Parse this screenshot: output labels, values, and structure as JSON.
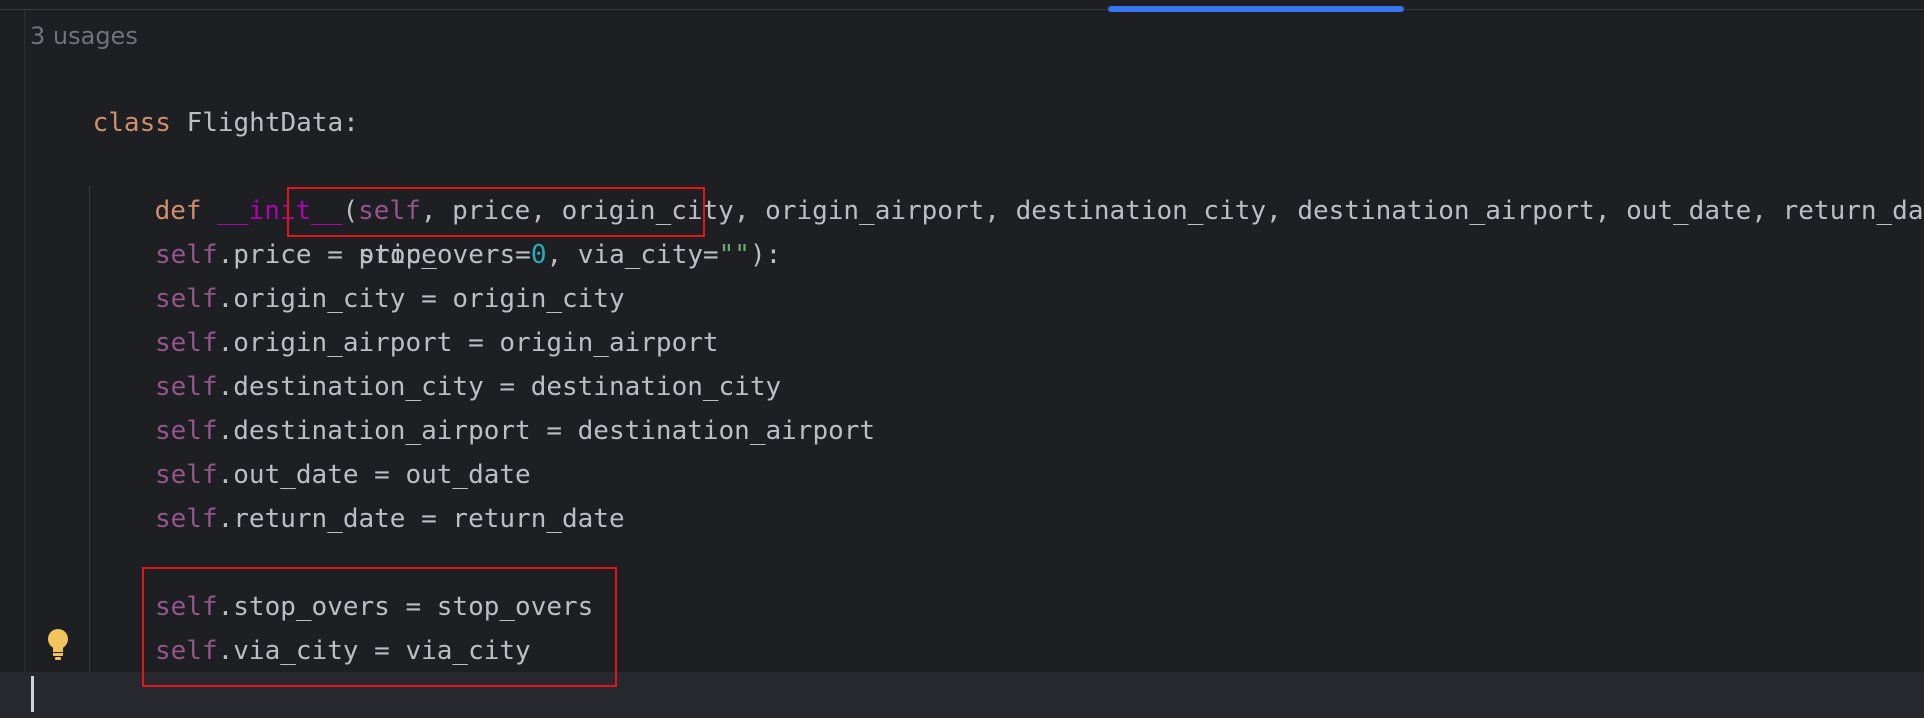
{
  "editor": {
    "usages_hint": "3 usages",
    "code": {
      "line_class": {
        "keyword": "class",
        "name": "FlightData",
        "colon": ":"
      },
      "line_def": {
        "keyword": "def",
        "func": "__init__",
        "open_paren": "(",
        "self": "self",
        "params": ", price, origin_city, origin_airport, destination_city, destination_airport, out_date, return_date,"
      },
      "line_def_cont": {
        "param1": "stop_overs=",
        "num": "0",
        "sep": ", via_city=",
        "str": "\"\"",
        "close": ")",
        "colon": ":"
      },
      "assignments": [
        {
          "self": "self",
          "rest": ".price = price"
        },
        {
          "self": "self",
          "rest": ".origin_city = origin_city"
        },
        {
          "self": "self",
          "rest": ".origin_airport = origin_airport"
        },
        {
          "self": "self",
          "rest": ".destination_city = destination_city"
        },
        {
          "self": "self",
          "rest": ".destination_airport = destination_airport"
        },
        {
          "self": "self",
          "rest": ".out_date = out_date"
        },
        {
          "self": "self",
          "rest": ".return_date = return_date"
        }
      ],
      "highlighted_assignments": [
        {
          "self": "self",
          "rest": ".stop_overs = stop_overs"
        },
        {
          "self": "self",
          "rest": ".via_city = via_city"
        }
      ]
    },
    "colors": {
      "background": "#1e1f22",
      "keyword": "#cf8e6d",
      "self": "#94558d",
      "dunder": "#b200b2",
      "number": "#2aacb8",
      "string": "#6aab73",
      "annotation_box": "#e0161b",
      "scroll_thumb": "#3574f0"
    },
    "icons": [
      "lightbulb-icon"
    ]
  }
}
